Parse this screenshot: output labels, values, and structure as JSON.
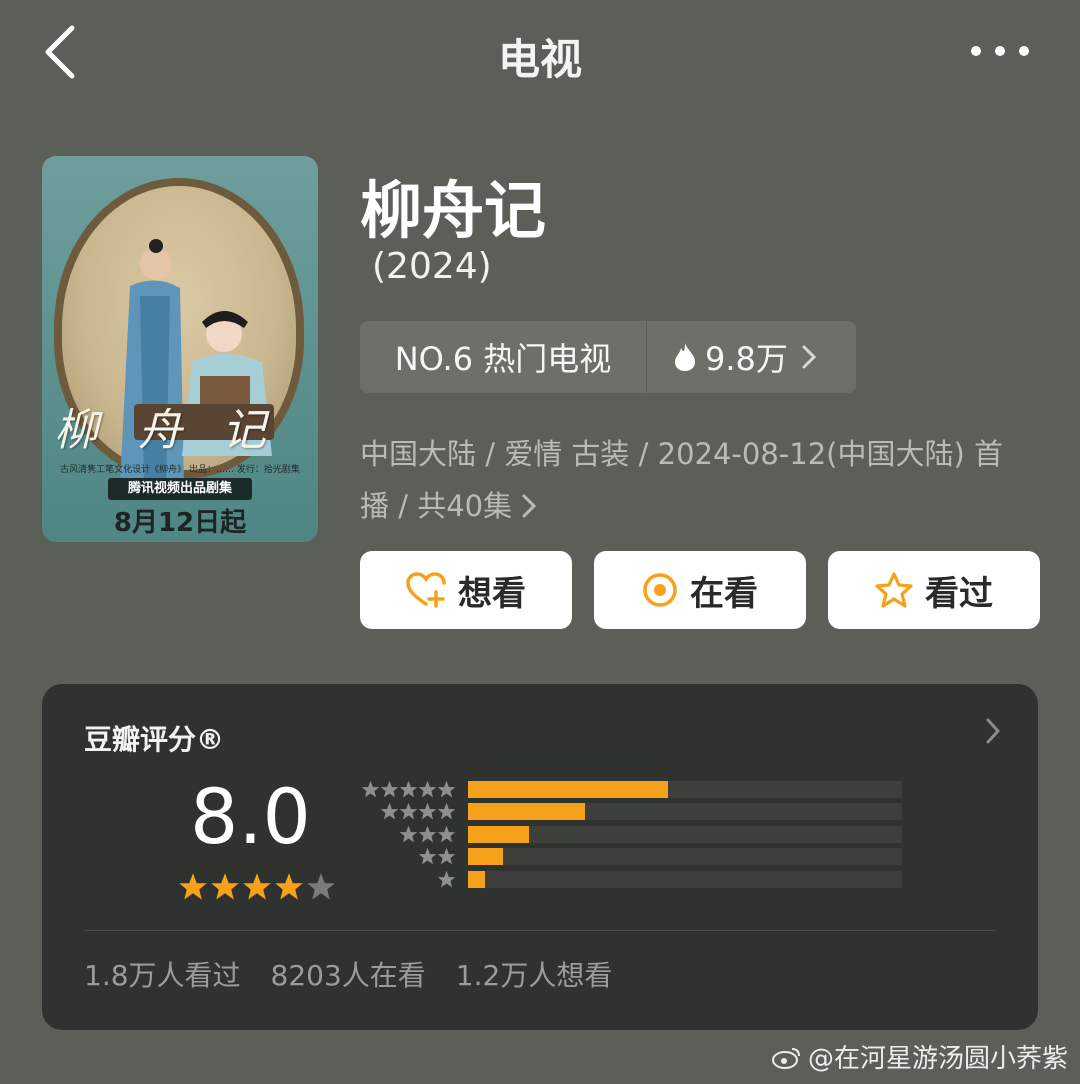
{
  "nav": {
    "title": "电视"
  },
  "poster": {
    "calligraphy": "柳舟记",
    "credits": "古风清隽工笔文化设计《柳舟》 出品：…… 发行：拾光剧集",
    "studio": "腾讯视频出品剧集",
    "date": "8月12日起"
  },
  "show": {
    "title": "柳舟记",
    "year": "(2024)",
    "rank": "NO.6 热门电视",
    "heat": "9.8万",
    "meta_line1": "中国大陆 / 爱情 古装 / 2024-08-12(中国大陆) 首",
    "meta_line2": "播 / 共40集"
  },
  "actions": [
    {
      "label": "想看",
      "icon": "heart-plus-icon"
    },
    {
      "label": "在看",
      "icon": "target-icon"
    },
    {
      "label": "看过",
      "icon": "star-outline-icon"
    }
  ],
  "rating": {
    "header": "豆瓣评分®",
    "score": "8.0",
    "stars": 4,
    "distribution": [
      {
        "stars": 5,
        "fraction": 0.46
      },
      {
        "stars": 4,
        "fraction": 0.27
      },
      {
        "stars": 3,
        "fraction": 0.14
      },
      {
        "stars": 2,
        "fraction": 0.08
      },
      {
        "stars": 1,
        "fraction": 0.04
      }
    ],
    "watched": "1.8万人看过",
    "watching": "8203人在看",
    "want": "1.2万人想看"
  },
  "colors": {
    "background": "#5b5f57",
    "accent": "#f5a11c",
    "card": "#2f322e"
  },
  "watermark": "@在河星游汤圆小荞紫"
}
